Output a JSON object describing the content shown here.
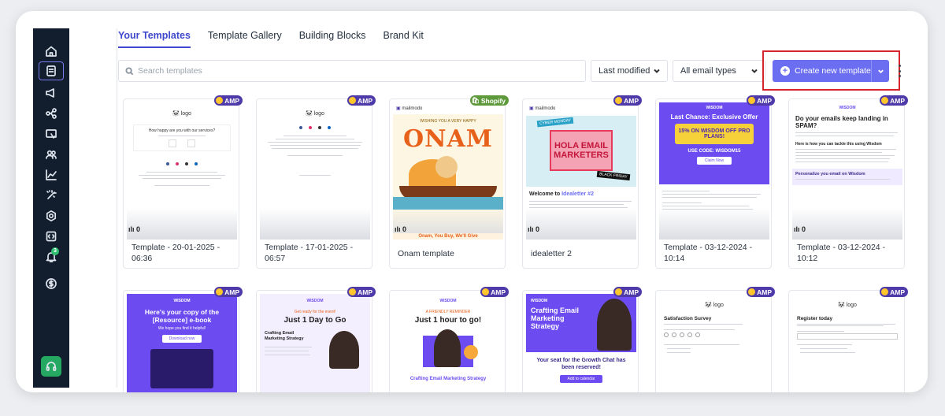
{
  "tabs": [
    {
      "label": "Your Templates",
      "active": true
    },
    {
      "label": "Template Gallery",
      "active": false
    },
    {
      "label": "Building Blocks",
      "active": false
    },
    {
      "label": "Brand Kit",
      "active": false
    }
  ],
  "search": {
    "placeholder": "Search templates"
  },
  "filters": {
    "sort": "Last modified",
    "type": "All email types"
  },
  "create_button": {
    "label": "Create new template"
  },
  "templates": [
    {
      "name": "Template - 20-01-2025 - 06:36",
      "badge": "AMP",
      "stat": "0",
      "preview": {
        "logo": "logo",
        "question": "How happy are you with our services?"
      }
    },
    {
      "name": "Template - 17-01-2025 - 06:57",
      "badge": "AMP",
      "stat": "",
      "preview": {
        "logo": "logo"
      }
    },
    {
      "name": "Onam template",
      "badge": "Shopify",
      "stat": "0",
      "preview": {
        "brand": "mailmodo",
        "greeting": "WISHING YOU A VERY HAPPY",
        "headline": "ONAM",
        "footer": "Onam, You Buy, We'll Give"
      }
    },
    {
      "name": "idealetter 2",
      "badge": "AMP",
      "stat": "0",
      "preview": {
        "brand": "mailmodo",
        "tag1": "CYBER MONDAY",
        "headline": "HOLA EMAIL MARKETERS",
        "tag2": "BLACK FRIDAY",
        "welcome": "Welcome to ",
        "welcome_accent": "Idealetter #2"
      }
    },
    {
      "name": "Template - 03-12-2024 - 10:14",
      "badge": "AMP",
      "stat": "",
      "preview": {
        "brand": "WISDOM",
        "headline": "Last Chance: Exclusive Offer",
        "offer": "15% ON WISDOM OFF PRO PLANS!",
        "code": "USE CODE: WISDOM15",
        "cta": "Claim Now"
      }
    },
    {
      "name": "Template - 03-12-2024 - 10:12",
      "badge": "AMP",
      "stat": "0",
      "preview": {
        "brand": "WISDOM",
        "headline": "Do your emails keep landing in SPAM?",
        "sub": "Here is how you can tackle this using Wisdom",
        "band": "Personalize you email on Wisdom"
      }
    },
    {
      "name": "",
      "badge": "AMP",
      "stat": "",
      "preview": {
        "brand": "WISDOM",
        "headline": "Here's your copy of the [Resource] e-book",
        "sub": "We hope you find it helpful!",
        "cta": "Download now"
      }
    },
    {
      "name": "",
      "badge": "AMP",
      "stat": "",
      "preview": {
        "brand": "WISDOM",
        "pre": "Get ready for the event!",
        "headline": "Just 1 Day to Go",
        "topic": "Crafting Email Marketing Strategy"
      }
    },
    {
      "name": "",
      "badge": "AMP",
      "stat": "",
      "preview": {
        "brand": "WISDOM",
        "pre": "A FRIENDLY REMINDER",
        "headline": "Just 1 hour to go!",
        "footer": "Crafting Email Marketing Strategy"
      }
    },
    {
      "name": "",
      "badge": "AMP",
      "stat": "",
      "preview": {
        "brand": "WISDOM",
        "headline": "Crafting Email Marketing Strategy",
        "seat": "Your seat for the Growth Chat has been reserved!",
        "cta": "Add to calendar"
      }
    },
    {
      "name": "",
      "badge": "AMP",
      "stat": "",
      "preview": {
        "logo": "logo",
        "headline": "Satisfaction Survey"
      }
    },
    {
      "name": "",
      "badge": "AMP",
      "stat": "",
      "preview": {
        "logo": "logo",
        "headline": "Register today"
      }
    }
  ],
  "colors": {
    "accent": "#6b6ef0",
    "sidebar": "#121e2e",
    "amp_badge": "#4e3aa8",
    "shopify_badge": "#5e9a3c",
    "highlight": "#d6262b"
  }
}
